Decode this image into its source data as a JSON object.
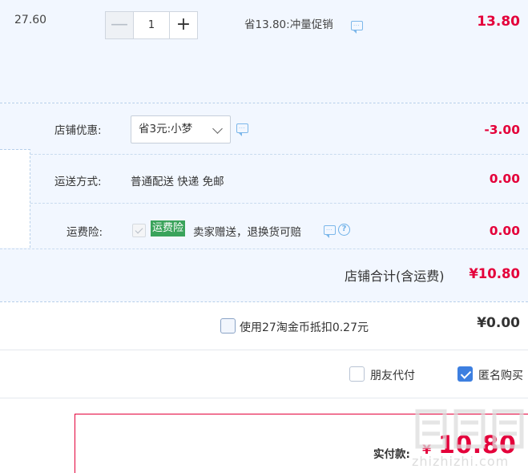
{
  "item": {
    "unit_price": "27.60",
    "quantity": "1",
    "minus_symbol": "—",
    "plus_symbol": "+",
    "promo_text": "省13.80:冲量促销",
    "promo_icon": "chat-bubble-icon",
    "subtotal": "13.80"
  },
  "shop": {
    "discount_label": "店铺优惠:",
    "discount_selected": "省3元:小梦",
    "discount_value": "-3.00",
    "shipping_label": "运送方式:",
    "shipping_text": "普通配送 快递 免邮",
    "shipping_value": "0.00",
    "insurance_label": "运费险:",
    "insurance_tag": "运费险",
    "insurance_text": "卖家赠送，退换货可赔",
    "insurance_help": "?",
    "insurance_value": "0.00",
    "total_label": "店铺合计(含运费)",
    "total_value": "¥10.80"
  },
  "coins": {
    "label": "使用27淘金币抵扣0.27元",
    "value": "¥0.00"
  },
  "options": {
    "friend_pay_label": "朋友代付",
    "anonymous_label": "匿名购买"
  },
  "payment": {
    "label": "实付款:",
    "currency": "¥",
    "value": "10.80"
  },
  "watermark": {
    "url": "zhizhizhi.com"
  },
  "colors": {
    "price_red": "#e4003a",
    "panel_bg": "#f2f7ff",
    "checkbox_blue": "#3d7fe0",
    "tag_green": "#3aa35b",
    "icon_blue": "#7cb7ea"
  }
}
